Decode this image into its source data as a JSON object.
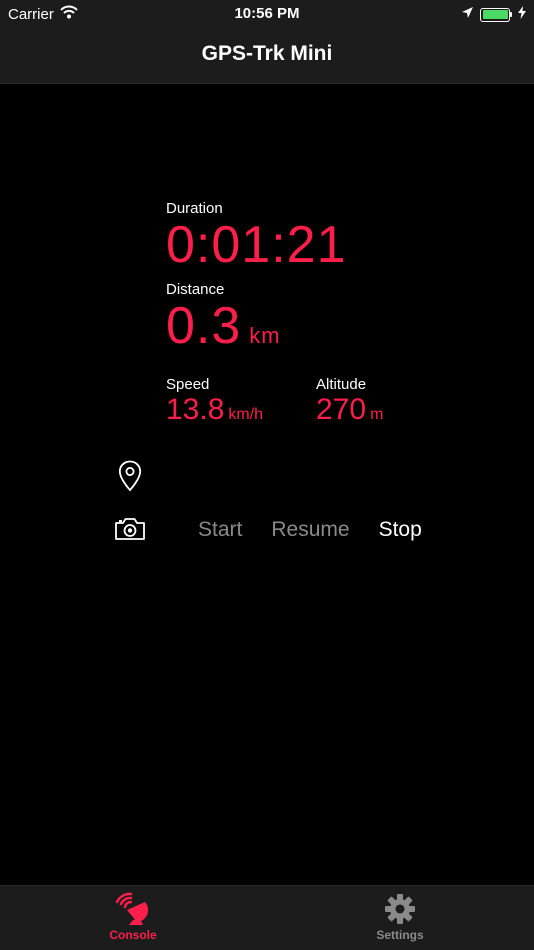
{
  "status_bar": {
    "carrier": "Carrier",
    "time": "10:56 PM",
    "battery_color": "#4cd964"
  },
  "nav": {
    "title": "GPS-Trk Mini"
  },
  "console": {
    "duration_label": "Duration",
    "duration_value": "0:01:21",
    "distance_label": "Distance",
    "distance_value": "0.3",
    "distance_unit": "km",
    "speed_label": "Speed",
    "speed_value": "13.8",
    "speed_unit": "km/h",
    "altitude_label": "Altitude",
    "altitude_value": "270",
    "altitude_unit": "m"
  },
  "controls": {
    "start": "Start",
    "resume": "Resume",
    "stop": "Stop"
  },
  "icons": {
    "pin": "map-pin-icon",
    "camera": "camera-icon",
    "console_tab": "satellite-dish-icon",
    "settings_tab": "gear-icon"
  },
  "tabs": [
    {
      "label": "Console",
      "active": true
    },
    {
      "label": "Settings",
      "active": false
    }
  ],
  "colors": {
    "accent": "#ff1f4a",
    "inactive": "#8a8a8a"
  }
}
